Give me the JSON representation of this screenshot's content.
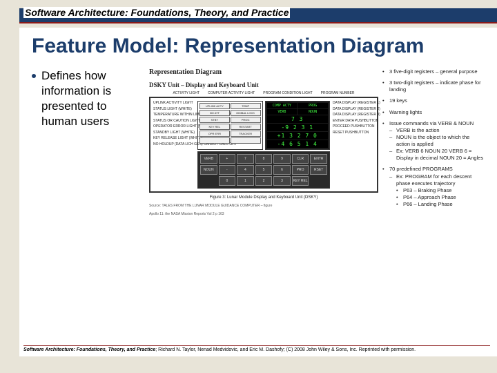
{
  "header": {
    "course": "Software Architecture: Foundations, Theory, and Practice"
  },
  "title": "Feature Model: Representation Diagram",
  "bullet": {
    "text": "Defines how information is presented to human users"
  },
  "diagram": {
    "heading": "Representation Diagram",
    "unit_label": "DSKY Unit – Display and Keyboard Unit",
    "top_labels": [
      "ACTIVITY LIGHT",
      "COMPUTER ACTIVITY LIGHT",
      "PROGRAM CONDITION LIGHT",
      "PROGRAM NUMBER"
    ],
    "left_labels": [
      "UPLINK ACTIVITY LIGHT",
      "STATUS LIGHT (WHITE)",
      "TEMPERATURE WITHIN LIMITS LIGHT (YELLOW)",
      "STATUS OR CAUTION LIGHT (YELLOW)",
      "OPERATOR ERROR LIGHT (WHITE)",
      "STANDBY LIGHT (WHITE)",
      "KEY RELEASE LIGHT (WHITE)",
      "NO HOLDUP (DATA LICH GEN) CANNOT CALC GHT"
    ],
    "right_labels": [
      "DATA DISPLAY (REGISTER 1)",
      "DATA DISPLAY (REGISTER 2)",
      "DATA DISPLAY (REGISTER 3)",
      "ENTER DATA PUSHBUTTON",
      "PROCEED PUSHBUTTON",
      "RESET PUSHBUTTON"
    ],
    "status_lights": [
      "UPLINK ACTY",
      "TEMP",
      "NO ATT",
      "GIMBAL LOCK",
      "STBY",
      "PROG",
      "KEY REL",
      "RESTART",
      "OPR ERR",
      "TRACKER",
      "",
      ""
    ],
    "display_cells_top": [
      "COMP ACTY",
      "PROG",
      "VERB",
      "NOUN"
    ],
    "display_registers": [
      "   7 3",
      "-9 2 3 1",
      "+1 3 2 7 0",
      "-4 6 5 1 4"
    ],
    "keys": [
      "VERB",
      "+",
      "7",
      "8",
      "9",
      "CLR",
      "ENTR",
      "NOUN",
      "-",
      "4",
      "5",
      "6",
      "PRO",
      "RSET",
      "",
      "0",
      "1",
      "2",
      "3",
      "KEY REL",
      ""
    ],
    "caption": "Figure 3: Lunar Module Display and Keyboard Unit (DSKY)",
    "source": "Source: TALES FROM THE LUNAR MODULE GUIDANCE COMPUTER – figure",
    "source2": "Apollo 11: the NASA Mission Reports Vol 2 p 163"
  },
  "notes": {
    "items": [
      "3 five-digit registers – general purpose",
      "3 two-digit registers – indicate phase for landing",
      "19 keys",
      "Warning lights",
      "Issue commands via VERB & NOUN",
      "70 predefined PROGRAMS"
    ],
    "verb_sub": [
      "VERB is the action",
      "NOUN is the object to which the action is applied",
      "Ex: VERB 6 NOUN 20 VERB 6 = Display in decimal NOUN 20 = Angles"
    ],
    "prog_sub": {
      "line": "Ex: PROGRAM for each descent phase executes trajectory",
      "items": [
        "P63 – Braking Phase",
        "P64 – Approach Phase",
        "P66 – Landing Phase"
      ]
    }
  },
  "footer": {
    "title": "Software Architecture: Foundations, Theory, and Practice",
    "rest": "; Richard N. Taylor, Nenad Medvidovic, and Eric M. Dashofy; (C) 2008 John Wiley & Sons, Inc. Reprinted with permission."
  }
}
